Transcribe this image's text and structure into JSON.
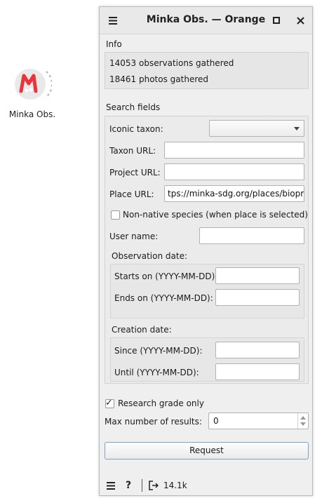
{
  "desktop": {
    "widget_label": "Minka Obs."
  },
  "window": {
    "title": "Minka Obs. — Orange"
  },
  "info": {
    "heading": "Info",
    "observations": "14053 observations gathered",
    "photos": "18461 photos gathered"
  },
  "search": {
    "heading": "Search fields",
    "iconic_taxon_label": "Iconic taxon:",
    "iconic_taxon_value": "",
    "taxon_url_label": "Taxon URL:",
    "taxon_url_value": "",
    "project_url_label": "Project URL:",
    "project_url_value": "",
    "place_url_label": "Place URL:",
    "place_url_value": "tps://minka-sdg.org/places/bioprat",
    "non_native_label": "Non-native species (when place is selected)",
    "non_native_checked": false,
    "user_name_label": "User name:",
    "user_name_value": "",
    "observation_date_heading": "Observation date:",
    "starts_on_label": "Starts on (YYYY-MM-DD):",
    "starts_on_value": "",
    "ends_on_label": "Ends on (YYYY-MM-DD):",
    "ends_on_value": "",
    "creation_date_heading": "Creation date:",
    "since_label": "Since (YYYY-MM-DD):",
    "since_value": "",
    "until_label": "Until (YYYY-MM-DD):",
    "until_value": ""
  },
  "options": {
    "research_grade_label": "Research grade only",
    "research_grade_checked": true,
    "max_results_label": "Max number of results:",
    "max_results_value": "0"
  },
  "request_button": "Request",
  "status": {
    "output_count": "14.1k"
  },
  "colors": {
    "accent": "#7ba2c8",
    "logo_red": "#e8343a"
  }
}
